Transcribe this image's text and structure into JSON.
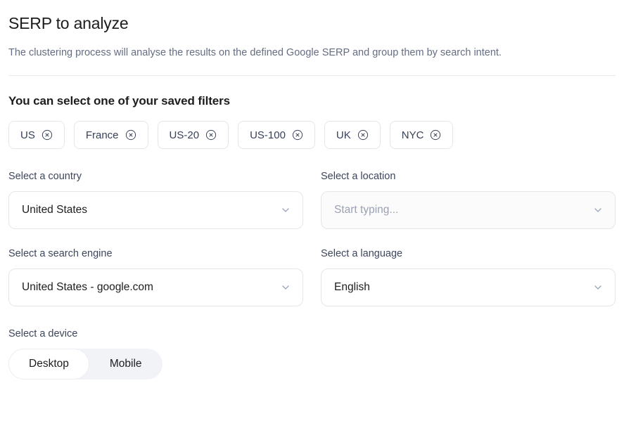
{
  "header": {
    "title": "SERP to analyze",
    "subtitle": "The clustering process will analyse the results on the defined Google SERP and group them by search intent."
  },
  "saved_filters": {
    "heading": "You can select one of your saved filters",
    "chips": [
      {
        "label": "US"
      },
      {
        "label": "France"
      },
      {
        "label": "US-20"
      },
      {
        "label": "US-100"
      },
      {
        "label": "UK"
      },
      {
        "label": "NYC"
      }
    ]
  },
  "form": {
    "country": {
      "label": "Select a country",
      "value": "United States",
      "placeholder": ""
    },
    "location": {
      "label": "Select a location",
      "value": "",
      "placeholder": "Start typing..."
    },
    "search_engine": {
      "label": "Select a search engine",
      "value": "United States - google.com",
      "placeholder": ""
    },
    "language": {
      "label": "Select a language",
      "value": "English",
      "placeholder": ""
    },
    "device": {
      "label": "Select a device",
      "options": [
        {
          "label": "Desktop",
          "selected": true
        },
        {
          "label": "Mobile",
          "selected": false
        }
      ]
    }
  },
  "colors": {
    "text_primary": "#1d1d20",
    "text_label": "#3d465c",
    "text_muted": "#646d82",
    "placeholder": "#9aa1b4",
    "border": "#e4e6ec",
    "divider": "#e7e9ee",
    "track": "#f2f3f7",
    "chip_text": "#38415a"
  }
}
